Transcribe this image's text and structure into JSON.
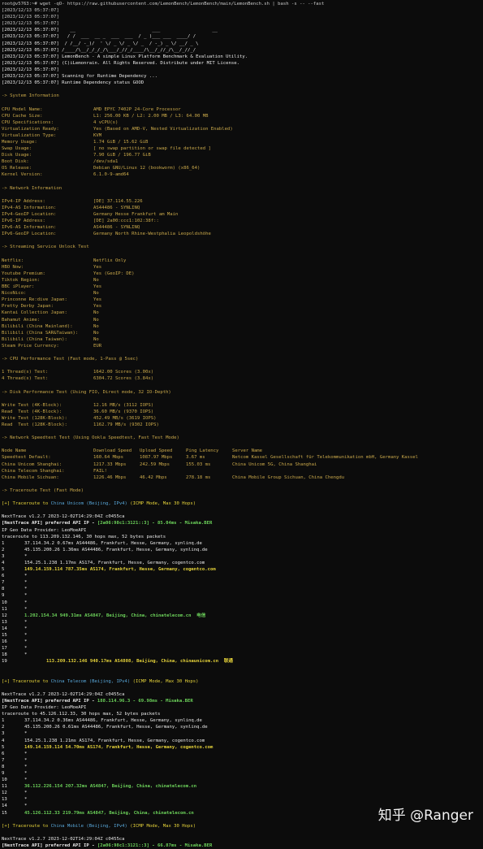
{
  "prompt_line": "root@v5763:~# wget -qO- https://raw.githubusercontent.com/LemonBench/LemonBench/main/LemonBench.sh | bash -s -- --fast",
  "ts": "[2023/12/13 05:37:07]",
  "logo": [
    "   __                            ___                   __",
    "  / /  ___  __ _  ___  ___  / _ )___ ___  ____/ /",
    " / /__/ -_)/  ' \\/ _ \\/ _ \\/ _  / -_) _ \\/ __/ _ \\",
    "/____/\\__/_/_/_/\\___/_//_/____/\\__/_//_/\\__/_//_/"
  ],
  "intro": [
    "LemonBench - A simple Linux Platform Benchmark & Evaluation Utility.",
    "(C)iLemonrain. All Rights Reserved. Distribute under MIT License.",
    "",
    "Scanning for Runtime Dependency ...",
    "Runtime Dependency status GOOD"
  ],
  "sysinfo": {
    "header": "-> System Information",
    "rows": [
      [
        "CPU Model Name:",
        "AMD EPYC 7402P 24-Core Processor"
      ],
      [
        "CPU Cache Size:",
        "L1: 256.00 KB / L2: 2.00 MB / L3: 64.00 MB"
      ],
      [
        "CPU Specifications:",
        "4 vCPU(s)"
      ],
      [
        "Virtualization Ready:",
        "Yes (Based on AMD-V, Nested Virtualization Enabled)"
      ],
      [
        "Virtualization Type:",
        "KVM"
      ],
      [
        "Memory Usage:",
        "1.74 GiB / 15.62 GiB"
      ],
      [
        "Swap Usage:",
        "[ no swap partition or swap file detected ]"
      ],
      [
        "Disk Usage:",
        "7.90 GiB / 196.77 GiB"
      ],
      [
        "Boot Disk:",
        "/dev/sda1"
      ],
      [
        "OS Release:",
        "Debian GNU/Linux 12 (bookworm) (x86_64)"
      ],
      [
        "Kernel Version:",
        "6.1.0-9-amd64"
      ]
    ]
  },
  "netinfo": {
    "header": "-> Network Information",
    "rows": [
      [
        "IPv4-IP Address:",
        "[DE] 37.114.55.226"
      ],
      [
        "IPv4-AS Information:",
        "AS44486 - SYNLINQ"
      ],
      [
        "IPv4-GeoIP Location:",
        "Germany Hesse Frankfurt am Main"
      ],
      [
        "IPv6-IP Address:",
        "[DE] 2a00:ccc1:102:38f::"
      ],
      [
        "IPv6-AS Information:",
        "AS44486 - SYNLINQ"
      ],
      [
        "IPv6-GeoIP Location:",
        "Germany North Rhine-Westphalia Leopoldshöhe"
      ]
    ]
  },
  "streaming": {
    "header": "-> Streaming Service Unlock Test",
    "rows": [
      [
        "Netflix:",
        "Netflix Only"
      ],
      [
        "HBO Now:",
        "Yes"
      ],
      [
        "Youtube Premium:",
        "Yes (GeoIP: DE)"
      ],
      [
        "Tiktok Region:",
        "No"
      ],
      [
        "BBC iPlayer:",
        "Yes"
      ],
      [
        "NicoNico:",
        "No"
      ],
      [
        "Princonne Re:dive Japan:",
        "Yes"
      ],
      [
        "Pretty Derby Japan:",
        "Yes"
      ],
      [
        "Kantai Collection Japan:",
        "No"
      ],
      [
        "Bahamut Anime:",
        "No"
      ],
      [
        "Bilibili (China Mainland):",
        "No"
      ],
      [
        "Bilibili (China SAR&Taiwan):",
        "No"
      ],
      [
        "Bilibili (China Taiwan):",
        "No"
      ],
      [
        "Steam Price Currency:",
        "EUR"
      ]
    ]
  },
  "cpu": {
    "header": "-> CPU Performance Test (Fast mode, 1-Pass @ 5sec)",
    "rows": [
      [
        "1 Thread(s) Test:",
        "1642.00 Scores (3.00x)"
      ],
      [
        "4 Thread(s) Test:",
        "6304.72 Scores (3.84x)"
      ]
    ]
  },
  "disk": {
    "header": "-> Disk Performance Test (Using FIO, Direct mode, 32 IO-Depth)",
    "rows": [
      [
        "Write Test (4K-Block):",
        "12.16 MB/s (3112 IOPS)"
      ],
      [
        "Read  Test (4K-Block):",
        "36.60 MB/s (9370 IOPS)"
      ],
      [
        "Write Test (128K-Block):",
        "452.49 MB/s (3619 IOPS)"
      ],
      [
        "Read  Test (128K-Block):",
        "1162.79 MB/s (9302 IOPS)"
      ]
    ]
  },
  "speedtest": {
    "header": "-> Network Speedtest Test (Using Ookla Speedtest, Fast Test Mode)",
    "columns": [
      "Node Name",
      "Download Speed",
      "Upload Speed",
      "Ping Latency",
      "Server Name"
    ],
    "rows": [
      [
        "Speedtest Default:",
        "160.64 Mbps",
        "1087.97 Mbps",
        "3.67 ms",
        "Netcom Kassel Gesellschaft für Telekommunikation mbH, Germany Kassel"
      ],
      [
        "China Unicom Shanghai:",
        "1217.33 Mbps",
        "242.59 Mbps",
        "155.03 ms",
        "China Unicom 5G, China Shanghai"
      ],
      [
        "China Telecom Shanghai:",
        "FAIL!",
        "",
        "",
        ""
      ],
      [
        "China Mobile Sichuan:",
        "1226.46 Mbps",
        "46.42 Mbps",
        "278.18 ms",
        "China Mobile Group Sichuan, China Chengdu"
      ]
    ]
  },
  "traceroute_header": "-> Traceroute Test (Fast Mode)",
  "trace1": {
    "title_pre": "[+] Traceroute to ",
    "title_target": "China Unicom (Beijing, IPv4)",
    "title_post": " (ICMP Mode, Max 30 Hops)",
    "version": "NextTrace v1.2.7 2023-12-02T14:29:04Z c0455ca",
    "api_pre": "[NextTrace API] preferred API IP - ",
    "api_ip": "[2a06:98c1:3121::3]",
    "api_post": " - 85.04ms - Misaka.BER",
    "provider": "IP Geo Data Provider: LeoMoeAPI",
    "trace_to": "traceroute to 113.209.132.146, 30 hops max, 52 bytes packets",
    "hops": [
      [
        "1",
        "37.114.34.2 0.67ms AS44486, Frankfurt, Hesse, Germany, synlinq.de",
        "w"
      ],
      [
        "2",
        "45.135.200.26 1.36ms AS44486, Frankfurt, Hesse, Germany, synlinq.de",
        "w"
      ],
      [
        "3",
        "*",
        "w"
      ],
      [
        "4",
        "154.25.1.238 1.17ms AS174, Frankfurt, Hesse, Germany, cogentco.com",
        "w"
      ],
      [
        "5",
        "149.14.159.114 787.35ms AS174, Frankfurt, Hesse, Germany, cogentco.com",
        "y"
      ],
      [
        "6",
        "*",
        "w"
      ],
      [
        "7",
        "*",
        "w"
      ],
      [
        "8",
        "*",
        "w"
      ],
      [
        "9",
        "*",
        "w"
      ],
      [
        "10",
        "*",
        "w"
      ],
      [
        "11",
        "*",
        "w"
      ],
      [
        "12",
        "1.202.154.34 949.31ms AS4847, Beijing, China, chinatelecom.cn  电信",
        "g"
      ],
      [
        "13",
        "*",
        "w"
      ],
      [
        "14",
        "*",
        "w"
      ],
      [
        "15",
        "*",
        "w"
      ],
      [
        "16",
        "*",
        "w"
      ],
      [
        "17",
        "*",
        "w"
      ],
      [
        "18",
        "*",
        "w"
      ],
      [
        "19",
        "        113.209.132.146 940.17ms AS4808, Beijing, China, chinaunicom.cn  联通",
        "y"
      ]
    ]
  },
  "trace2": {
    "title_pre": "[+] Traceroute to ",
    "title_target": "China Telecom (Beijing, IPv4)",
    "title_post": " (ICMP Mode, Max 30 Hops)",
    "version": "NextTrace v1.2.7 2023-12-02T14:29:04Z c0455ca",
    "api_pre": "[NextTrace API] preferred API IP - ",
    "api_ip": "188.114.96.3",
    "api_post": " - 69.98ms - Misaka.BER",
    "provider": "IP Geo Data Provider: LeoMoeAPI",
    "trace_to": "traceroute to 45.126.112.33, 30 hops max, 52 bytes packets",
    "hops": [
      [
        "1",
        "37.114.34.2 0.36ms AS44486, Frankfurt, Hesse, Germany, synlinq.de",
        "w"
      ],
      [
        "2",
        "45.135.200.26 0.61ms AS44486, Frankfurt, Hesse, Germany, synlinq.de",
        "w"
      ],
      [
        "3",
        "*",
        "w"
      ],
      [
        "4",
        "154.25.1.238 1.21ms AS174, Frankfurt, Hesse, Germany, cogentco.com",
        "w"
      ],
      [
        "5",
        "149.14.159.114 54.70ms AS174, Frankfurt, Hesse, Germany, cogentco.com",
        "y"
      ],
      [
        "6",
        "*",
        "w"
      ],
      [
        "7",
        "*",
        "w"
      ],
      [
        "8",
        "*",
        "w"
      ],
      [
        "9",
        "*",
        "w"
      ],
      [
        "10",
        "*",
        "w"
      ],
      [
        "11",
        "36.112.226.154 207.32ms AS4847, Beijing, China, chinatelecom.cn",
        "g"
      ],
      [
        "12",
        "*",
        "w"
      ],
      [
        "13",
        "*",
        "w"
      ],
      [
        "14",
        "*",
        "w"
      ],
      [
        "15",
        "45.126.112.33 219.79ms AS4847, Beijing, China, chinatelecom.cn",
        "g"
      ]
    ]
  },
  "trace3": {
    "title_pre": "[+] Traceroute to ",
    "title_target": "China Mobile (Beijing, IPv4)",
    "title_post": " (ICMP Mode, Max 30 Hops)",
    "version": "NextTrace v1.2.7 2023-12-02T14:29:04Z c0455ca",
    "api_pre": "[NextTrace API] preferred API IP - ",
    "api_ip": "[2a06:98c1:3121::3]",
    "api_post": " - 66.87ms - Misaka.BER"
  },
  "watermark": "知乎 @Ranger"
}
